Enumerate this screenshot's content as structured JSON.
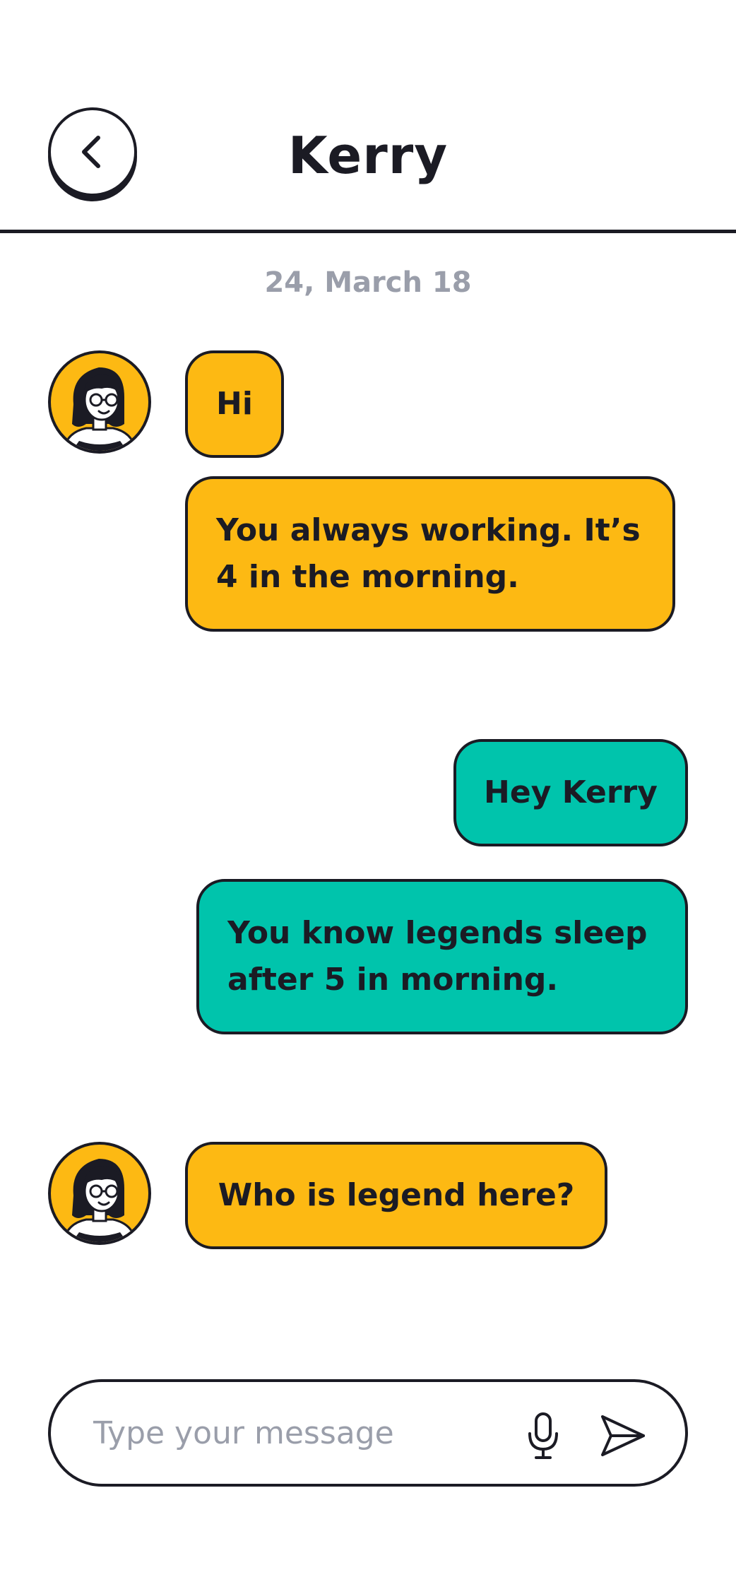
{
  "header": {
    "title": "Kerry",
    "back_icon": "chevron-left-icon"
  },
  "conversation": {
    "date": "24, March 18",
    "messages": [
      {
        "from": "contact",
        "text": "Hi"
      },
      {
        "from": "contact",
        "text": "You always working. It’s 4 in the morning."
      },
      {
        "from": "me",
        "text": "Hey Kerry"
      },
      {
        "from": "me",
        "text": "You know legends sleep after 5 in morning."
      },
      {
        "from": "contact",
        "text": "Who is legend here?"
      }
    ]
  },
  "composer": {
    "value": "",
    "placeholder": "Type your message",
    "mic_icon": "microphone-icon",
    "send_icon": "send-icon"
  },
  "colors": {
    "incoming_bubble": "#fdb913",
    "outgoing_bubble": "#00c4ac",
    "outline": "#1b1b24",
    "muted_text": "#9a9eaa",
    "background": "#ffffff"
  }
}
